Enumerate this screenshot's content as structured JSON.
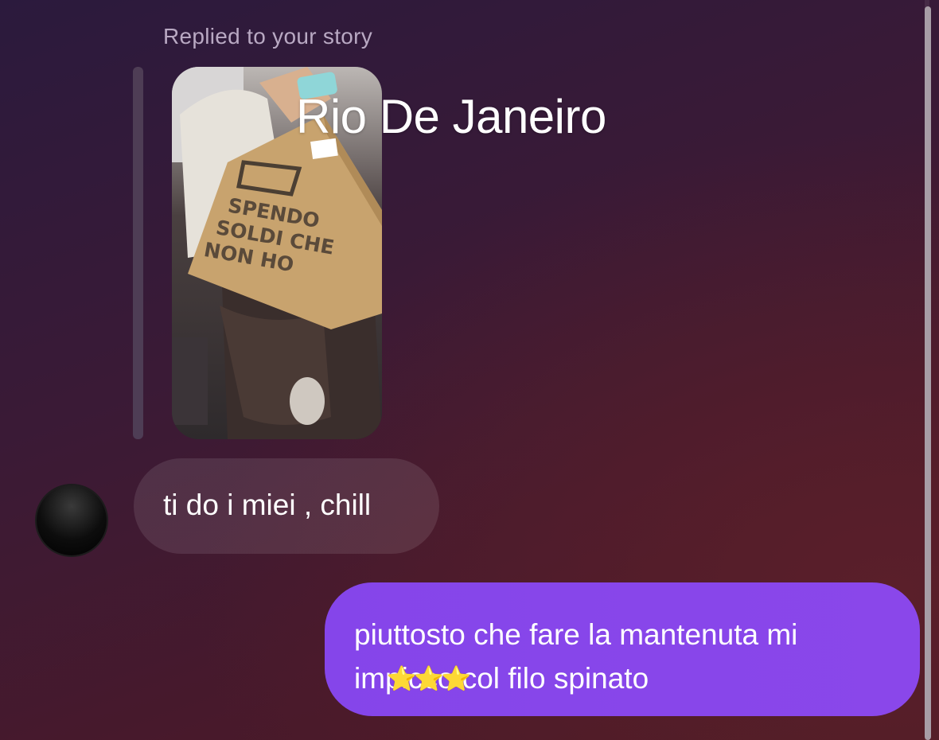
{
  "chat": {
    "reply_label": "Replied to your story",
    "story": {
      "caption": "Rio De Janeiro",
      "bag_text": [
        "SPENDO",
        "SOLDI CHE",
        "NON HO"
      ]
    },
    "messages": [
      {
        "from": "them",
        "text": "ti do i miei , chill"
      },
      {
        "from": "me",
        "text": "piuttosto che fare la mantenuta mi impicco col filo spinato",
        "overlay": "⭐⭐⭐"
      }
    ]
  },
  "colors": {
    "outgoing_bubble": "#8545ea",
    "incoming_bubble": "rgba(255,255,255,0.1)",
    "background": "#3a1a36"
  }
}
